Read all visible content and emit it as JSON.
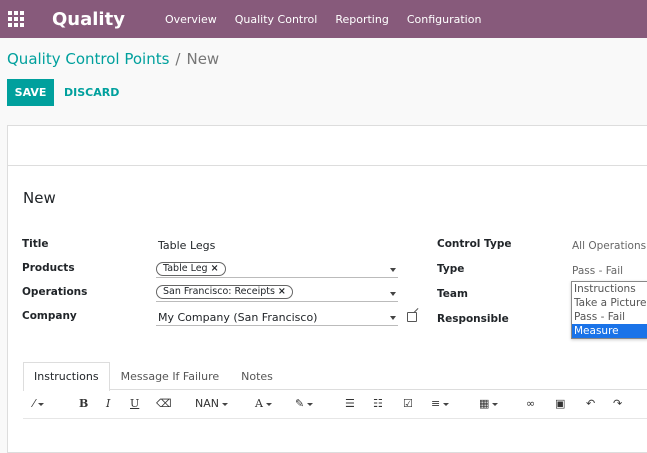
{
  "navbar": {
    "app_name": "Quality",
    "menu": [
      "Overview",
      "Quality Control",
      "Reporting",
      "Configuration"
    ]
  },
  "breadcrumb": {
    "parent": "Quality Control Points",
    "separator": "/",
    "current": "New"
  },
  "buttons": {
    "save": "SAVE",
    "discard": "DISCARD"
  },
  "form": {
    "record_title": "New",
    "title": {
      "label": "Title",
      "value": "Table Legs"
    },
    "products": {
      "label": "Products",
      "tags": [
        "Table Leg"
      ]
    },
    "operations": {
      "label": "Operations",
      "tags": [
        "San Francisco: Receipts"
      ]
    },
    "company": {
      "label": "Company",
      "value": "My Company (San Francisco)"
    },
    "control_type": {
      "label": "Control Type",
      "value": "All Operations"
    },
    "type": {
      "label": "Type",
      "value": "Pass - Fail"
    },
    "team": {
      "label": "Team"
    },
    "responsible": {
      "label": "Responsible"
    }
  },
  "type_dropdown": {
    "options": [
      "Instructions",
      "Take a Picture",
      "Pass - Fail",
      "Measure"
    ],
    "highlighted": "Measure"
  },
  "tabs": [
    "Instructions",
    "Message If Failure",
    "Notes"
  ],
  "toolbar": {
    "bold": "B",
    "italic": "I",
    "underline": "U",
    "font_size": "NAN",
    "font": "A"
  },
  "colors": {
    "navbar": "#875a7b",
    "accent": "#00a09d",
    "highlight": "#1a73e8"
  }
}
